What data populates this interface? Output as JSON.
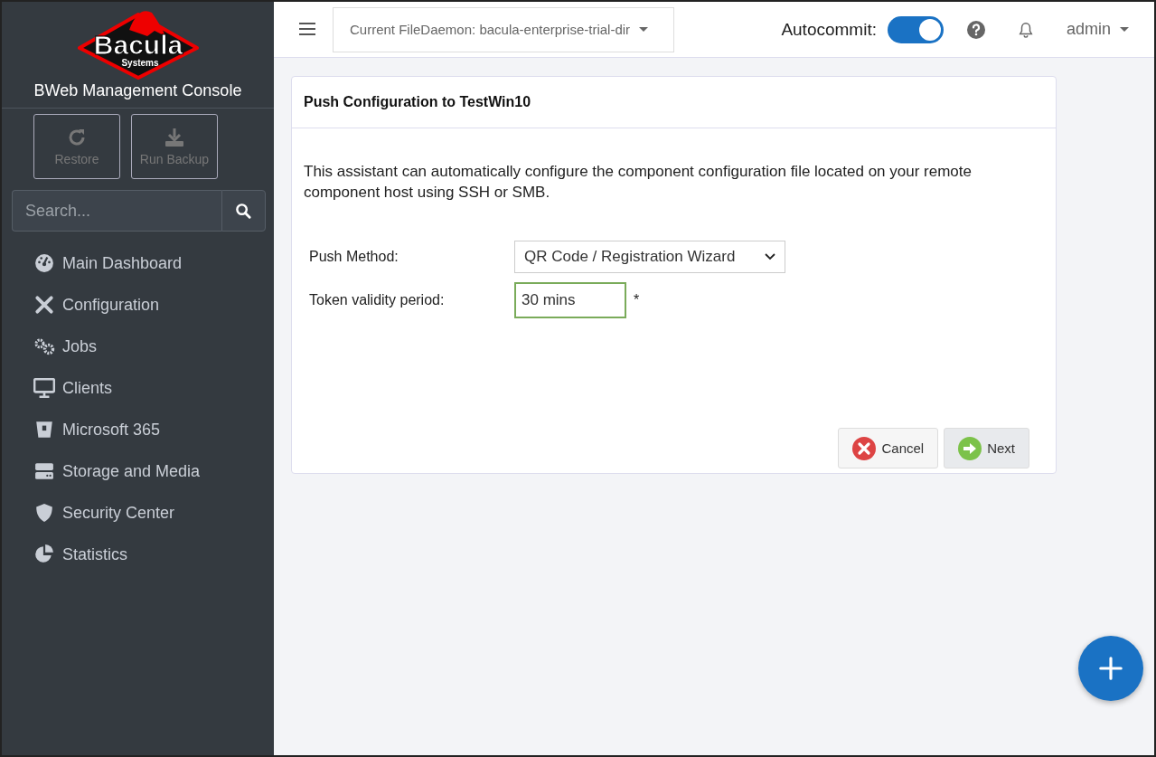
{
  "sidebar": {
    "logo": {
      "word": "Bacula",
      "sub": "Systems"
    },
    "title": "BWeb Management Console",
    "actions": [
      {
        "label": "Restore"
      },
      {
        "label": "Run Backup"
      }
    ],
    "search": {
      "placeholder": "Search..."
    },
    "items": [
      {
        "label": "Main Dashboard"
      },
      {
        "label": "Configuration"
      },
      {
        "label": "Jobs"
      },
      {
        "label": "Clients"
      },
      {
        "label": "Microsoft 365"
      },
      {
        "label": "Storage and Media"
      },
      {
        "label": "Security Center"
      },
      {
        "label": "Statistics"
      }
    ]
  },
  "topbar": {
    "filedaemon": "Current FileDaemon: bacula-enterprise-trial-dir",
    "autocommit_label": "Autocommit:",
    "autocommit_on": true,
    "user": "admin"
  },
  "card": {
    "title": "Push Configuration to TestWin10",
    "intro": "This assistant can automatically configure the component configuration file located on your remote component host using SSH or SMB.",
    "fields": [
      {
        "kind": "select",
        "label": "Push Method:",
        "value": "QR Code / Registration Wizard"
      },
      {
        "kind": "text",
        "label": "Token validity period:",
        "value": "30 mins",
        "required": "*"
      }
    ],
    "buttons": [
      {
        "kind": "cancel",
        "label": "Cancel"
      },
      {
        "kind": "next",
        "label": "Next"
      }
    ]
  }
}
